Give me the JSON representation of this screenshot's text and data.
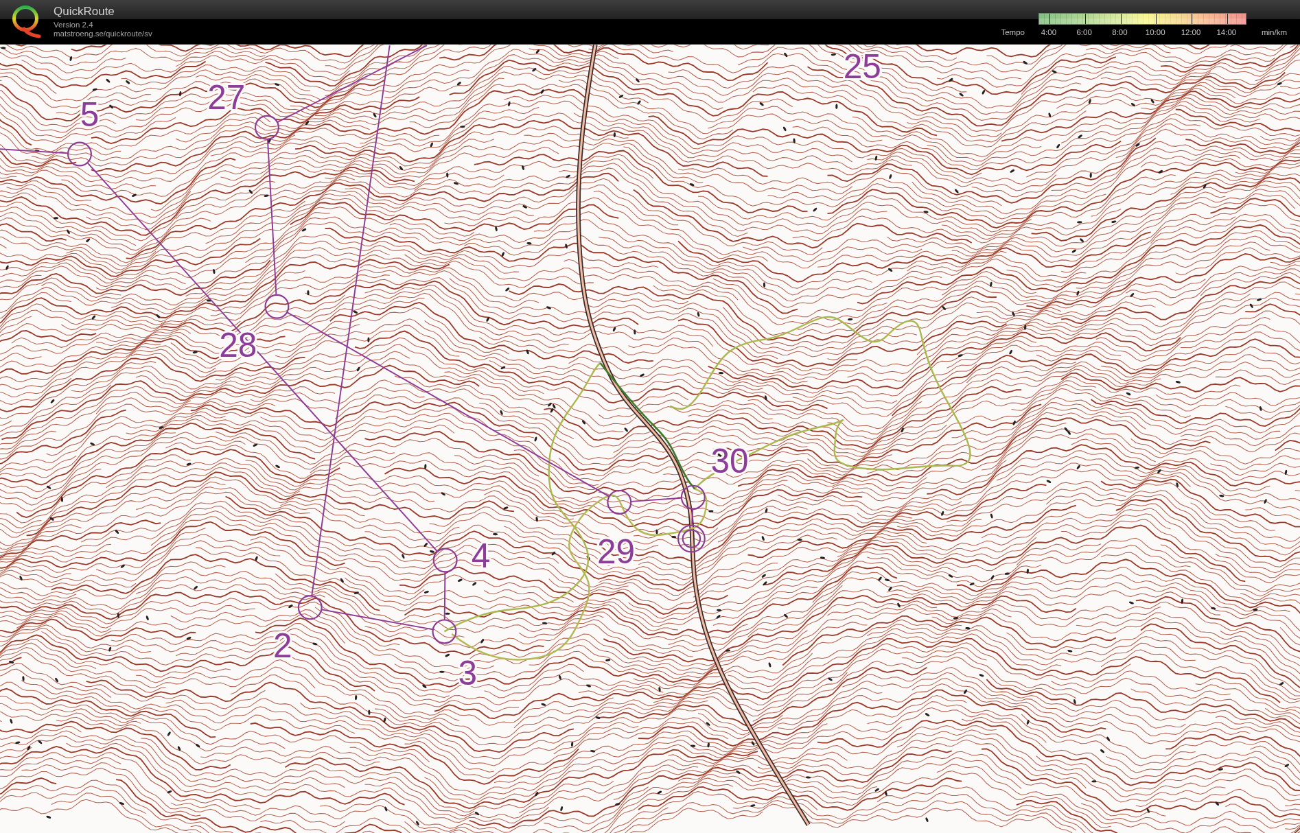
{
  "app": {
    "title": "QuickRoute",
    "version": "Version 2.4",
    "url": "matstroeng.se/quickroute/sv"
  },
  "tempo_scale": {
    "label": "Tempo",
    "ticks": [
      "4:00",
      "6:00",
      "8:00",
      "10:00",
      "12:00",
      "14:00"
    ],
    "unit": "min/km"
  },
  "map": {
    "control_numbers": [
      "25",
      "27",
      "5",
      "28",
      "30",
      "29",
      "4",
      "2",
      "3"
    ]
  }
}
